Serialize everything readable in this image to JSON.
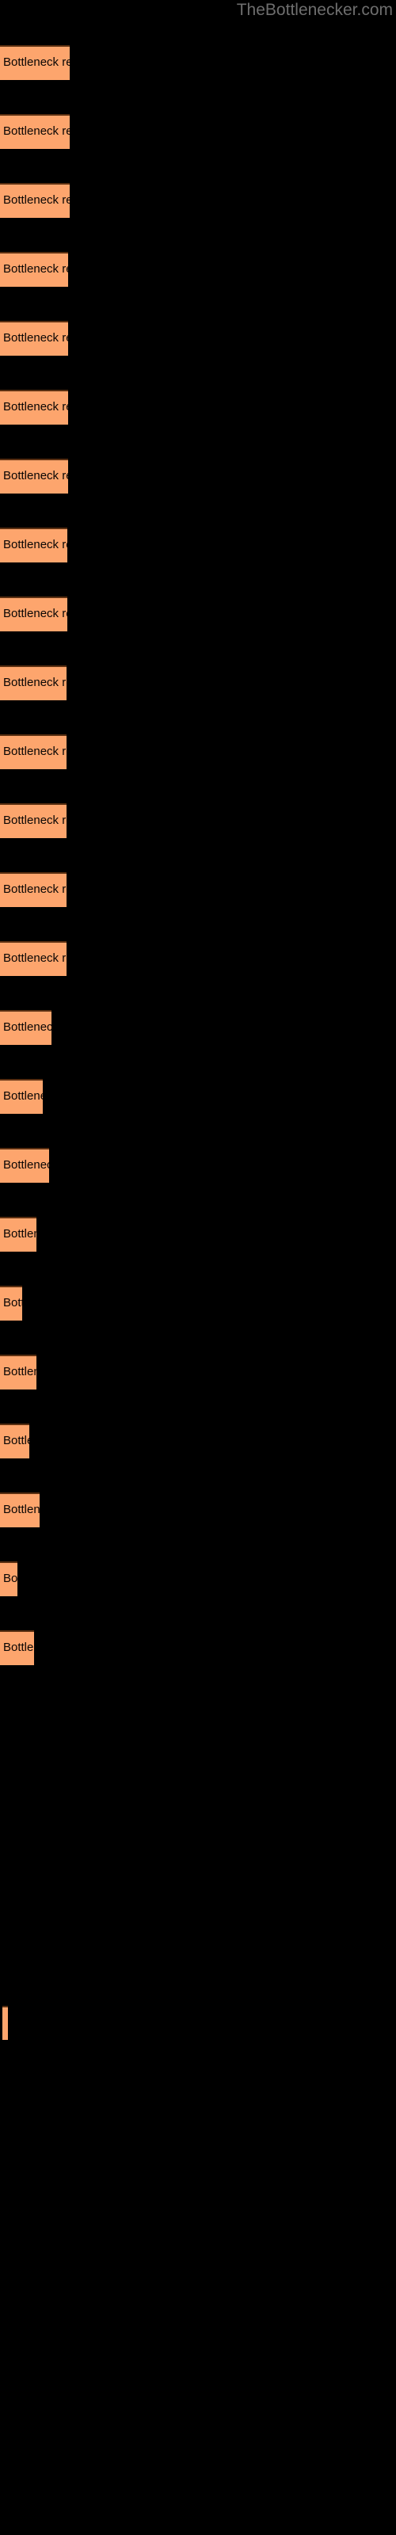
{
  "site": {
    "title": "TheBottlenecker.com",
    "title_color": "#6e6e6e"
  },
  "style": {
    "background": "#000000",
    "bar_fill": "#fda56d",
    "bar_border_top": "#5a2f11",
    "label_color": "#0a0604"
  },
  "chart_data": {
    "type": "bar",
    "orientation": "horizontal",
    "title": "TheBottlenecker.com",
    "xlabel": "",
    "ylabel": "",
    "grid": false,
    "legend": "none",
    "series_name": "Bottleneck result",
    "bar_label_text": "Bottleneck result",
    "axis_labels_visible": false,
    "xlim": [
      0,
      500
    ],
    "categories": [
      "bar-1",
      "bar-2",
      "bar-3",
      "bar-4",
      "bar-5",
      "bar-6",
      "bar-7",
      "bar-8",
      "bar-9",
      "bar-10",
      "bar-11",
      "bar-12",
      "bar-13",
      "bar-14",
      "bar-15",
      "bar-16",
      "bar-17",
      "bar-18",
      "bar-19",
      "bar-20",
      "bar-21",
      "bar-22",
      "bar-23"
    ],
    "values": [
      88,
      88,
      88,
      86,
      86,
      86,
      86,
      85,
      85,
      84,
      84,
      84,
      84,
      84,
      65,
      54,
      62,
      46,
      28,
      46,
      37,
      50,
      22,
      43,
      7
    ],
    "bars": [
      {
        "name": "bar-1",
        "y": 57,
        "width": 88,
        "label": "Bottleneck result"
      },
      {
        "name": "bar-2",
        "y": 144,
        "width": 88,
        "label": "Bottleneck result"
      },
      {
        "name": "bar-3",
        "y": 231,
        "width": 88,
        "label": "Bottleneck result"
      },
      {
        "name": "bar-4",
        "y": 318,
        "width": 86,
        "label": "Bottleneck result"
      },
      {
        "name": "bar-5",
        "y": 405,
        "width": 86,
        "label": "Bottleneck result"
      },
      {
        "name": "bar-6",
        "y": 492,
        "width": 86,
        "label": "Bottleneck result"
      },
      {
        "name": "bar-7",
        "y": 579,
        "width": 86,
        "label": "Bottleneck result"
      },
      {
        "name": "bar-8",
        "y": 666,
        "width": 85,
        "label": "Bottleneck result"
      },
      {
        "name": "bar-9",
        "y": 753,
        "width": 85,
        "label": "Bottleneck result"
      },
      {
        "name": "bar-10",
        "y": 840,
        "width": 84,
        "label": "Bottleneck result"
      },
      {
        "name": "bar-11",
        "y": 927,
        "width": 84,
        "label": "Bottleneck result"
      },
      {
        "name": "bar-12",
        "y": 1014,
        "width": 84,
        "label": "Bottleneck result"
      },
      {
        "name": "bar-13",
        "y": 1101,
        "width": 84,
        "label": "Bottleneck result"
      },
      {
        "name": "bar-14",
        "y": 1188,
        "width": 84,
        "label": "Bottleneck result"
      },
      {
        "name": "bar-15",
        "y": 1275,
        "width": 65,
        "label": "Bottleneck result"
      },
      {
        "name": "bar-16",
        "y": 1362,
        "width": 54,
        "label": "Bottleneck result"
      },
      {
        "name": "bar-17",
        "y": 1449,
        "width": 62,
        "label": "Bottleneck result"
      },
      {
        "name": "bar-18",
        "y": 1536,
        "width": 46,
        "label": "Bottleneck result"
      },
      {
        "name": "bar-19",
        "y": 1623,
        "width": 28,
        "label": "Bottleneck result"
      },
      {
        "name": "bar-20",
        "y": 1710,
        "width": 46,
        "label": "Bottleneck result"
      },
      {
        "name": "bar-21",
        "y": 1797,
        "width": 37,
        "label": "Bottleneck result"
      },
      {
        "name": "bar-22",
        "y": 1884,
        "width": 50,
        "label": "Bottleneck result"
      },
      {
        "name": "bar-23",
        "y": 1971,
        "width": 22,
        "label": "Bottleneck result"
      },
      {
        "name": "bar-24",
        "y": 2058,
        "width": 43,
        "label": "Bottleneck result"
      },
      {
        "name": "bar-25",
        "y": 2532,
        "width": 7,
        "label": "",
        "height": 43
      }
    ]
  }
}
